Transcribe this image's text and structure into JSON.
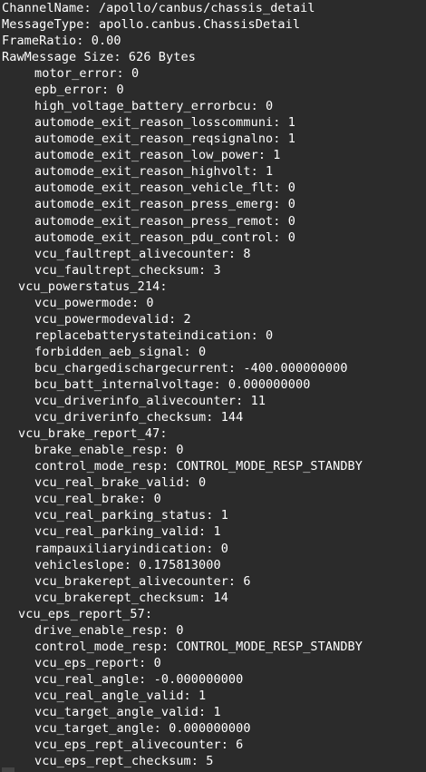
{
  "header": {
    "channel_line": "ChannelName: /apollo/canbus/chassis_detail",
    "message_type_line": "MessageType: apollo.canbus.ChassisDetail",
    "frame_ratio_line": "FrameRatio: 0.00",
    "raw_message_size_line": "RawMessage Size: 626 Bytes"
  },
  "lines": [
    {
      "text": "motor_error: 0",
      "level": 2
    },
    {
      "text": "epb_error: 0",
      "level": 2
    },
    {
      "text": "high_voltage_battery_errorbcu: 0",
      "level": 2
    },
    {
      "text": "automode_exit_reason_losscommuni: 1",
      "level": 2
    },
    {
      "text": "automode_exit_reason_reqsignalno: 1",
      "level": 2
    },
    {
      "text": "automode_exit_reason_low_power: 1",
      "level": 2
    },
    {
      "text": "automode_exit_reason_highvolt: 1",
      "level": 2
    },
    {
      "text": "automode_exit_reason_vehicle_flt: 0",
      "level": 2
    },
    {
      "text": "automode_exit_reason_press_emerg: 0",
      "level": 2
    },
    {
      "text": "automode_exit_reason_press_remot: 0",
      "level": 2
    },
    {
      "text": "automode_exit_reason_pdu_control: 0",
      "level": 2
    },
    {
      "text": "vcu_faultrept_alivecounter: 8",
      "level": 2
    },
    {
      "text": "vcu_faultrept_checksum: 3",
      "level": 2
    },
    {
      "text": "vcu_powerstatus_214:",
      "level": 1
    },
    {
      "text": "vcu_powermode: 0",
      "level": 2
    },
    {
      "text": "vcu_powermodevalid: 2",
      "level": 2
    },
    {
      "text": "replacebatterystateindication: 0",
      "level": 2
    },
    {
      "text": "forbidden_aeb_signal: 0",
      "level": 2
    },
    {
      "text": "bcu_chargedischargecurrent: -400.000000000",
      "level": 2
    },
    {
      "text": "bcu_batt_internalvoltage: 0.000000000",
      "level": 2
    },
    {
      "text": "vcu_driverinfo_alivecounter: 11",
      "level": 2
    },
    {
      "text": "vcu_driverinfo_checksum: 144",
      "level": 2
    },
    {
      "text": "vcu_brake_report_47:",
      "level": 1
    },
    {
      "text": "brake_enable_resp: 0",
      "level": 2
    },
    {
      "text": "control_mode_resp: CONTROL_MODE_RESP_STANDBY",
      "level": 2
    },
    {
      "text": "vcu_real_brake_valid: 0",
      "level": 2
    },
    {
      "text": "vcu_real_brake: 0",
      "level": 2
    },
    {
      "text": "vcu_real_parking_status: 1",
      "level": 2
    },
    {
      "text": "vcu_real_parking_valid: 1",
      "level": 2
    },
    {
      "text": "rampauxiliaryindication: 0",
      "level": 2
    },
    {
      "text": "vehicleslope: 0.175813000",
      "level": 2
    },
    {
      "text": "vcu_brakerept_alivecounter: 6",
      "level": 2
    },
    {
      "text": "vcu_brakerept_checksum: 14",
      "level": 2
    },
    {
      "text": "vcu_eps_report_57:",
      "level": 1
    },
    {
      "text": "drive_enable_resp: 0",
      "level": 2
    },
    {
      "text": "control_mode_resp: CONTROL_MODE_RESP_STANDBY",
      "level": 2
    },
    {
      "text": "vcu_eps_report: 0",
      "level": 2
    },
    {
      "text": "vcu_real_angle: -0.000000000",
      "level": 2
    },
    {
      "text": "vcu_real_angle_valid: 1",
      "level": 2
    },
    {
      "text": "vcu_target_angle_valid: 1",
      "level": 2
    },
    {
      "text": "vcu_target_angle: 0.000000000",
      "level": 2
    },
    {
      "text": "vcu_eps_rept_alivecounter: 6",
      "level": 2
    },
    {
      "text": "vcu_eps_rept_checksum: 5",
      "level": 2
    }
  ],
  "colors": {
    "background": "#2b2b2b",
    "text": "#ffffff"
  }
}
